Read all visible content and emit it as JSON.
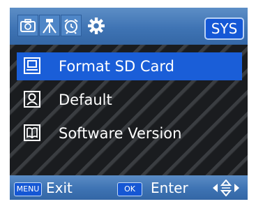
{
  "header": {
    "tabs": [
      {
        "icon": "camera-icon",
        "active": false
      },
      {
        "icon": "tripod-icon",
        "active": false
      },
      {
        "icon": "alarm-clock-icon",
        "active": false
      },
      {
        "icon": "gear-icon",
        "active": true
      }
    ],
    "section_badge": "SYS"
  },
  "menu": {
    "items": [
      {
        "label": "Format SD Card",
        "icon": "sd-card-icon",
        "selected": true
      },
      {
        "label": "Default",
        "icon": "reset-icon",
        "selected": false
      },
      {
        "label": "Software Version",
        "icon": "book-icon",
        "selected": false
      }
    ]
  },
  "footer": {
    "menu_key": "MENU",
    "menu_action": "Exit",
    "ok_key": "OK",
    "ok_action": "Enter",
    "nav_icon": "dpad-arrows-icon"
  },
  "colors": {
    "bar_blue": "#3f74b4",
    "selection_blue": "#1a5ed8",
    "text": "#ffffff"
  }
}
